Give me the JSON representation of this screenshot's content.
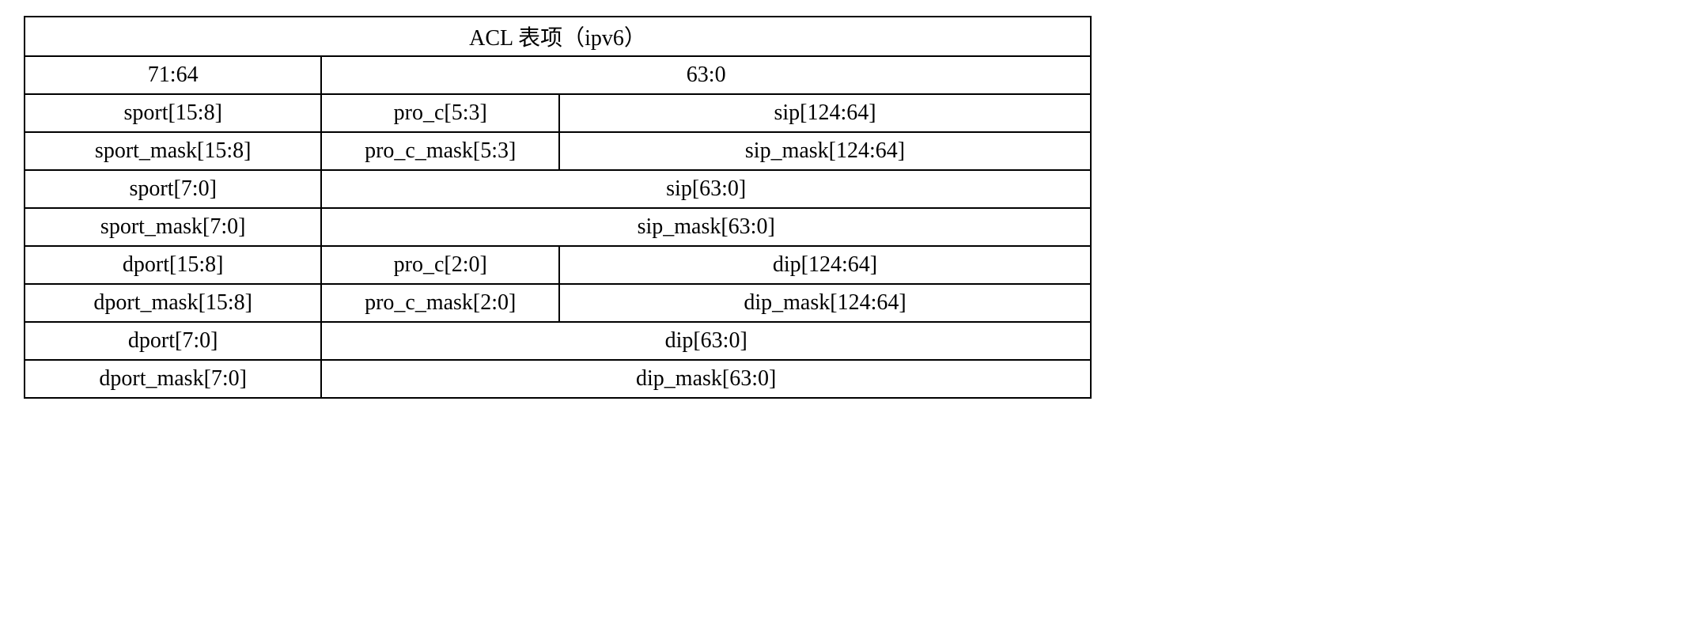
{
  "table": {
    "title": "ACL 表项（ipv6）",
    "header": {
      "left": "71:64",
      "right": "63:0"
    },
    "rows": [
      {
        "c1": "sport[15:8]",
        "c2": "pro_c[5:3]",
        "c3": "sip[124:64]"
      },
      {
        "c1": "sport_mask[15:8]",
        "c2": "pro_c_mask[5:3]",
        "c3": "sip_mask[124:64]"
      },
      {
        "c1": "sport[7:0]",
        "c23": "sip[63:0]"
      },
      {
        "c1": "sport_mask[7:0]",
        "c23": "sip_mask[63:0]"
      },
      {
        "c1": "dport[15:8]",
        "c2": "pro_c[2:0]",
        "c3": "dip[124:64]"
      },
      {
        "c1": "dport_mask[15:8]",
        "c2": "pro_c_mask[2:0]",
        "c3": "dip_mask[124:64]"
      },
      {
        "c1": "dport[7:0]",
        "c23": "dip[63:0]"
      },
      {
        "c1": "dport_mask[7:0]",
        "c23": "dip_mask[63:0]"
      }
    ]
  }
}
